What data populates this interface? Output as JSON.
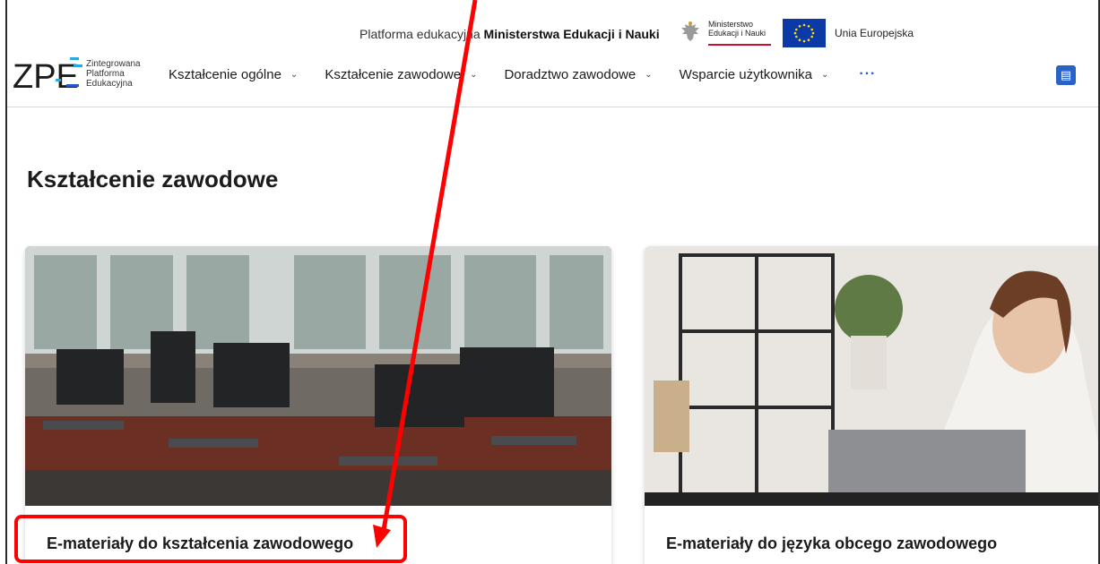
{
  "header": {
    "platform_prefix": "Platforma edukacyjna ",
    "platform_ministry": "Ministerstwa Edukacji i Nauki",
    "ministry_logo_line1": "Ministerstwo",
    "ministry_logo_line2": "Edukacji i Nauki",
    "eu_label": "Unia Europejska"
  },
  "logo": {
    "mark": "ZPE",
    "line1": "Zintegrowana",
    "line2": "Platforma",
    "line3": "Edukacyjna"
  },
  "nav": {
    "items": [
      {
        "label": "Kształcenie ogólne"
      },
      {
        "label": "Kształcenie zawodowe"
      },
      {
        "label": "Doradztwo zawodowe"
      },
      {
        "label": "Wsparcie użytkownika"
      }
    ],
    "more_label": "···"
  },
  "page": {
    "title": "Kształcenie zawodowe"
  },
  "cards": [
    {
      "title": "E-materiały do kształcenia zawodowego"
    },
    {
      "title": "E-materiały do języka obcego zawodowego"
    }
  ],
  "colors": {
    "annotation": "#ff0000",
    "accent": "#2a63c7",
    "eu_blue": "#0b3aa6",
    "ministry_red": "#c8102e"
  }
}
